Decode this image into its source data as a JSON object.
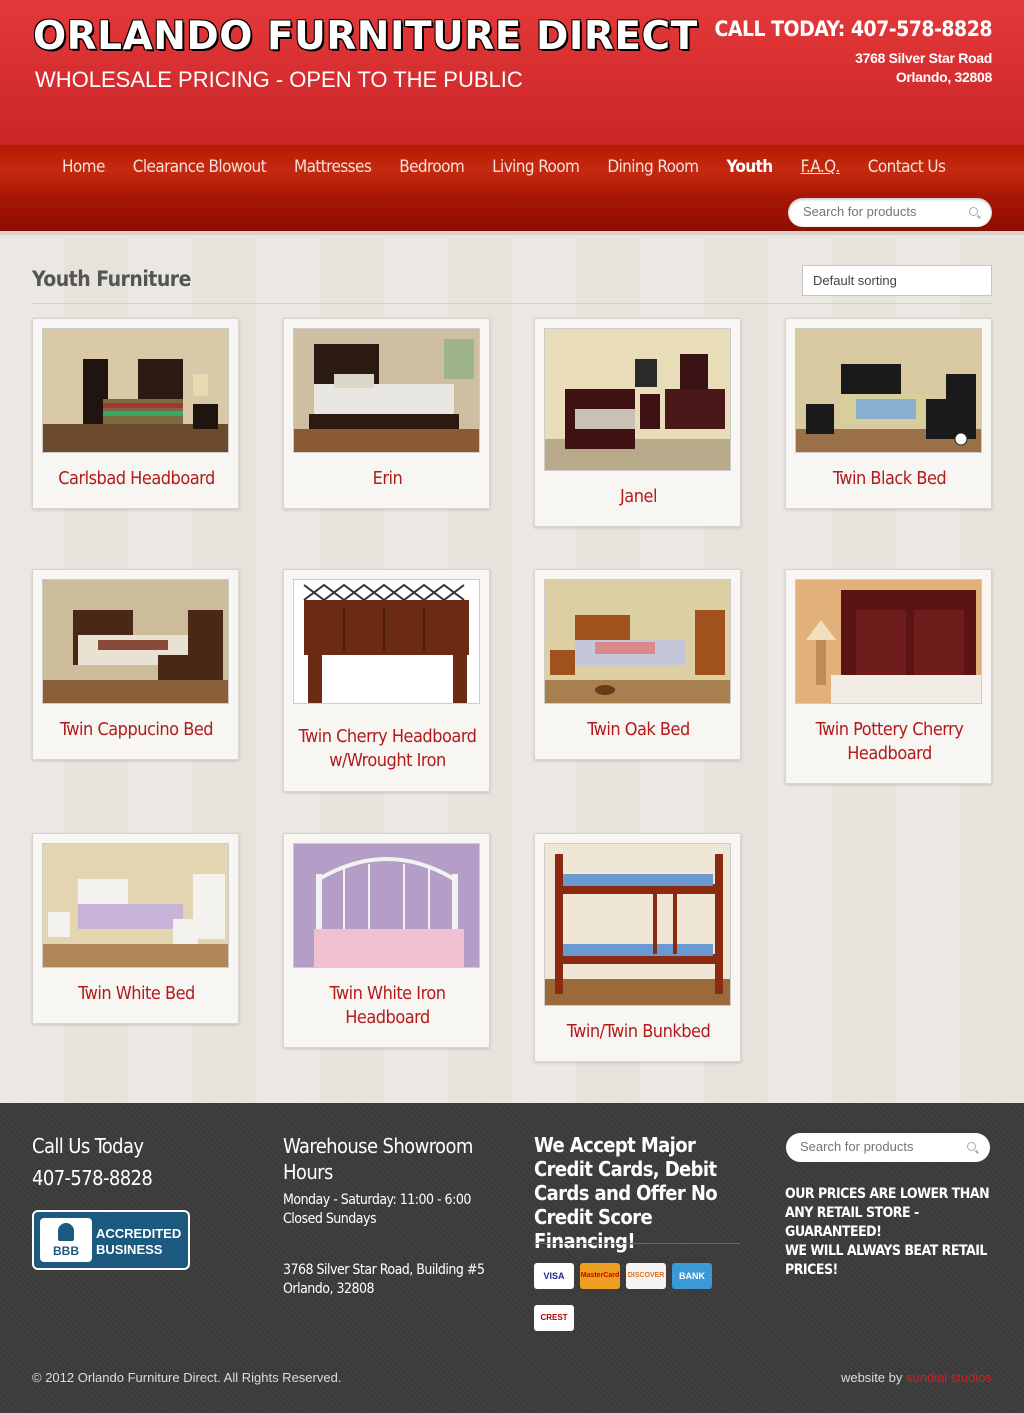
{
  "header": {
    "logo_title": "ORLANDO FURNITURE DIRECT",
    "logo_tagline": "WHOLESALE PRICING - OPEN TO THE PUBLIC",
    "call_today": "CALL TODAY: 407-578-8828",
    "address_line1": "3768 Silver Star Road",
    "address_line2": "Orlando, 32808"
  },
  "nav": {
    "items": [
      "Home",
      "Clearance Blowout",
      "Mattresses",
      "Bedroom",
      "Living Room",
      "Dining Room",
      "Youth",
      "F.A.Q.",
      "Contact Us"
    ],
    "active": "Youth",
    "search_placeholder": "Search for products"
  },
  "main": {
    "title": "Youth Furniture",
    "sorting_value": "Default sorting",
    "products": [
      {
        "name": "Carlsbad Headboard"
      },
      {
        "name": "Erin"
      },
      {
        "name": "Janel"
      },
      {
        "name": "Twin Black Bed"
      },
      {
        "name": "Twin Cappucino Bed"
      },
      {
        "name": "Twin Cherry Headboard w/Wrought Iron"
      },
      {
        "name": "Twin Oak Bed"
      },
      {
        "name": "Twin Pottery Cherry Headboard"
      },
      {
        "name": "Twin White Bed"
      },
      {
        "name": "Twin White Iron Headboard"
      },
      {
        "name": "Twin/Twin Bunkbed"
      }
    ]
  },
  "footer": {
    "call_heading": "Call Us Today",
    "call_phone": "407-578-8828",
    "bbb_text_1": "ACCREDITED",
    "bbb_text_2": "BUSINESS",
    "bbb_seal": "BBB",
    "hours_heading": "Warehouse Showroom Hours",
    "hours_line1": "Monday - Saturday: 11:00 - 6:00",
    "hours_line2": "Closed Sundays",
    "address_line1": "3768 Silver Star Road, Building #5",
    "address_line2": "Orlando, 32808",
    "credit_heading": "We Accept Major Credit Cards, Debit Cards and Offer No Credit Score Financing!",
    "card_logos": [
      "VISA",
      "MasterCard",
      "DISCOVER",
      "BANK",
      "CREST"
    ],
    "search_placeholder": "Search for products",
    "promo1": "OUR PRICES ARE LOWER THAN ANY RETAIL STORE - GUARANTEED!",
    "promo2": "WE WILL ALWAYS BEAT RETAIL PRICES!",
    "copyright": "© 2012 Orlando Furniture Direct. All Rights Reserved.",
    "credit_prefix": "website by",
    "credit_link": "sundial studios"
  },
  "colors": {
    "header_red": "#d62e30",
    "nav_red": "#b81a05",
    "product_name": "#b31b1b",
    "footer_bg": "#3a3a3a"
  }
}
